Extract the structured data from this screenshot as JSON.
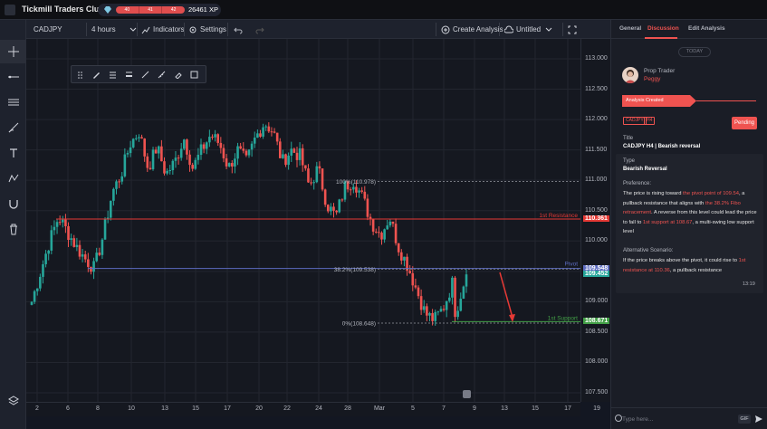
{
  "app": {
    "title": "Tickmill Traders Club",
    "xp_levels": [
      "40",
      "41",
      "42"
    ],
    "xp_value": "26461 XP",
    "xp_progress": 0.68
  },
  "chart_toolbar": {
    "symbol": "CADJPY",
    "interval": "4 hours",
    "indicators_label": "Indicators",
    "settings_label": "Settings",
    "create_analysis_label": "Create Analysis",
    "layout_label": "Untitled"
  },
  "left_tools": [
    "crosshair-icon",
    "horizontal-line-icon",
    "parallel-lines-icon",
    "brush-icon",
    "text-icon",
    "pattern-icon",
    "magnet-icon",
    "trash-icon"
  ],
  "draw_toolbar": [
    "drag-handle-icon",
    "pencil-icon",
    "line-style-icon",
    "line-width-icon",
    "color-icon",
    "ruler-icon",
    "eraser-icon",
    "frame-icon"
  ],
  "price_axis": {
    "labels": [
      "113.000",
      "112.500",
      "112.000",
      "111.500",
      "111.000",
      "110.500",
      "110.000",
      "109.500",
      "109.000",
      "108.500",
      "108.000",
      "107.500"
    ],
    "markers": [
      {
        "label": "110.361",
        "price": 110.361,
        "color": "#e53935"
      },
      {
        "label": "109.548",
        "price": 109.548,
        "color": "#5c6bc0"
      },
      {
        "label": "109.452",
        "price": 109.452,
        "color": "#26a69a"
      },
      {
        "label": "108.671",
        "price": 108.671,
        "color": "#43a047"
      }
    ]
  },
  "time_axis": {
    "labels": [
      "2",
      "6",
      "8",
      "10",
      "13",
      "15",
      "17",
      "20",
      "22",
      "24",
      "28",
      "Mar",
      "5",
      "7",
      "9",
      "13",
      "15",
      "17",
      "19"
    ]
  },
  "annotations": {
    "fib_100": "100%(110.978)",
    "fib_382": "38.2%(109.538)",
    "fib_0": "0%(108.648)",
    "resistance": "1st Resistance",
    "pivot": "Pivot",
    "support": "1st Support"
  },
  "chart_data": {
    "type": "candlestick",
    "symbol": "CADJPY",
    "interval": "4 hours",
    "ylim": [
      107.3,
      113.2
    ],
    "x_ticks": [
      "2",
      "6",
      "8",
      "10",
      "13",
      "15",
      "17",
      "20",
      "22",
      "24",
      "28",
      "Mar",
      "5",
      "7",
      "9",
      "13",
      "15",
      "17",
      "19"
    ],
    "close_path": [
      109.0,
      109.5,
      110.0,
      110.4,
      110.15,
      109.9,
      109.7,
      109.55,
      110.1,
      110.8,
      111.1,
      111.6,
      111.8,
      111.2,
      111.55,
      111.1,
      111.3,
      111.7,
      111.2,
      111.5,
      111.75,
      111.6,
      111.2,
      111.5,
      111.3,
      111.7,
      111.95,
      111.8,
      111.3,
      111.5,
      111.4,
      110.9,
      111.2,
      110.6,
      110.4,
      110.9,
      111.0,
      110.7,
      110.3,
      110.1,
      110.4,
      109.9,
      109.6,
      109.2,
      108.8,
      108.7,
      108.9,
      109.3
    ]
  },
  "panel": {
    "tabs": [
      "General",
      "Discussion",
      "Edit Analysis"
    ],
    "active_tab": 1,
    "today_chip": "TODAY",
    "author_role": "Prop Trader",
    "author_name": "Peggy",
    "created_label": "Analysis Created",
    "tags": [
      "CADJPY",
      "H4"
    ],
    "status": "Pending",
    "title_label": "Title",
    "title_value": "CADJPY H4 | Bearish reversal",
    "type_label": "Type",
    "type_value": "Bearish Reversal",
    "preference_label": "Preference:",
    "pref_parts": [
      "The price is rising toward ",
      "the pivot point of 109.54",
      ", a pullback resistance that aligns with ",
      "the 38.2% Fibo retracement",
      ".  A reverse from this level could lead the price to fall to ",
      "1st support at 108.67",
      ", a multi-swing low support level"
    ],
    "alt_label": "Alternative Scenario:",
    "alt_parts": [
      " If the price breaks above the pivot, it could rise to ",
      "1st resistance at 110.36",
      ", a pullback resistance"
    ],
    "msg_time": "13:19",
    "compose_placeholder": "Type here...",
    "gif_label": "GIF"
  }
}
